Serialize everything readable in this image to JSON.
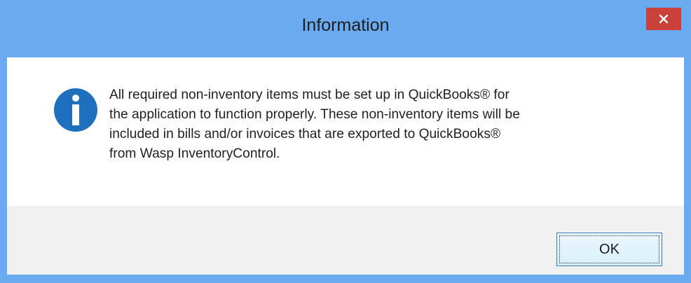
{
  "dialog": {
    "title": "Information",
    "close_icon": "close-icon",
    "info_icon": "info-icon",
    "message": "All required non-inventory items must be set up in QuickBooks® for\nthe application to function properly. These non-inventory items will be\nincluded in bills and/or invoices that are exported to QuickBooks®\nfrom Wasp InventoryControl.",
    "ok_label": "OK"
  },
  "colors": {
    "titlebar": "#6aaaf1",
    "close_button": "#c94138",
    "info_icon": "#1f6fbf",
    "footer": "#f0f0f0"
  }
}
